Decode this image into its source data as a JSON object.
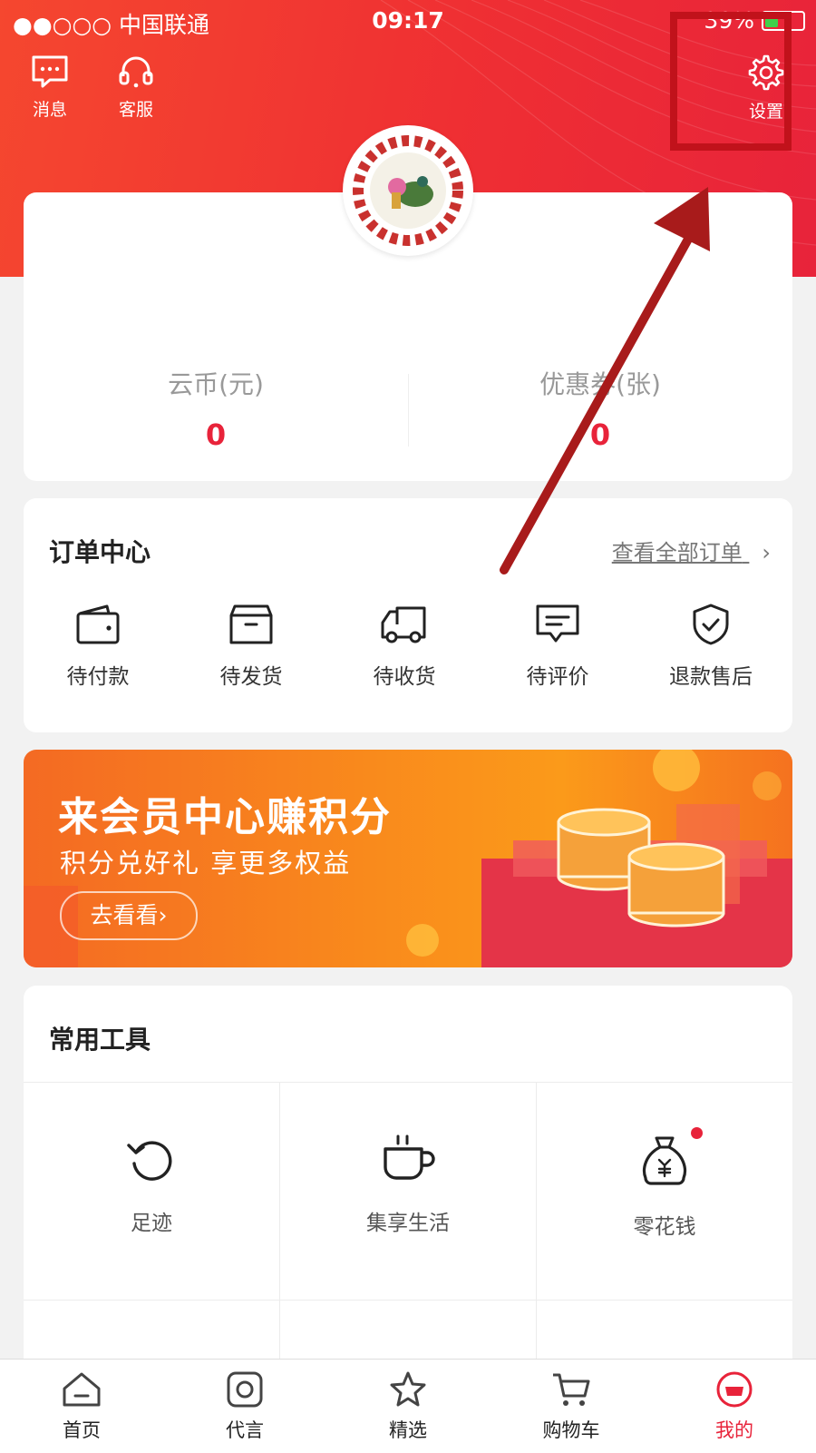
{
  "status_bar": {
    "carrier": "●●○○○ 中国联通",
    "time": "09:17",
    "battery": "39%"
  },
  "header": {
    "left_buttons": [
      {
        "label": "消息",
        "icon": "message-icon"
      },
      {
        "label": "客服",
        "icon": "headset-icon"
      }
    ],
    "settings": {
      "label": "设置",
      "icon": "gear-icon"
    }
  },
  "account": {
    "stats": [
      {
        "title": "云币(元)",
        "value": "0"
      },
      {
        "title": "优惠券(张)",
        "value": "0"
      }
    ]
  },
  "orders": {
    "title": "订单中心",
    "view_all": "查看全部订单",
    "items": [
      {
        "label": "待付款",
        "icon": "wallet-icon"
      },
      {
        "label": "待发货",
        "icon": "box-icon"
      },
      {
        "label": "待收货",
        "icon": "truck-icon"
      },
      {
        "label": "待评价",
        "icon": "comment-icon"
      },
      {
        "label": "退款售后",
        "icon": "shield-check-icon"
      }
    ]
  },
  "banner": {
    "headline": "来会员中心赚积分",
    "subline": "积分兑好礼  享更多权益",
    "button": "去看看›"
  },
  "tools": {
    "title": "常用工具",
    "items": [
      {
        "label": "足迹",
        "icon": "history-icon"
      },
      {
        "label": "集享生活",
        "icon": "coffee-cup-icon"
      },
      {
        "label": "零花钱",
        "icon": "money-bag-icon",
        "badge": true
      }
    ]
  },
  "tabbar": {
    "items": [
      {
        "label": "首页",
        "icon": "home-icon"
      },
      {
        "label": "代言",
        "icon": "camera-icon"
      },
      {
        "label": "精选",
        "icon": "star-icon"
      },
      {
        "label": "购物车",
        "icon": "cart-icon"
      },
      {
        "label": "我的",
        "icon": "profile-icon",
        "active": true
      }
    ]
  },
  "colors": {
    "accent": "#e8233a",
    "annotation": "#c1121b"
  }
}
